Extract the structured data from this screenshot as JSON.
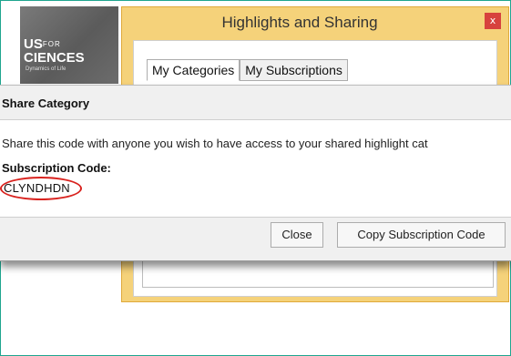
{
  "background_logo": {
    "line1_main": "US",
    "line1_small": "FOR",
    "line2": "CIENCES",
    "line3": "Dynamics of Life"
  },
  "highlights_window": {
    "title": "Highlights and Sharing",
    "close_glyph": "x",
    "tabs": [
      {
        "label": "My Categories",
        "active": true
      },
      {
        "label": "My Subscriptions",
        "active": false
      }
    ]
  },
  "share_dialog": {
    "title": "Share Category",
    "message": "Share this code with anyone you wish to have access to your shared highlight cat",
    "code_label": "Subscription Code:",
    "code_value": "CLYNDHDN",
    "buttons": {
      "close": "Close",
      "copy": "Copy Subscription Code"
    }
  },
  "colors": {
    "frame": "#1fa58f",
    "window_bg": "#f5d27a",
    "close_btn": "#d7423d",
    "annotation_circle": "#d9231f"
  }
}
